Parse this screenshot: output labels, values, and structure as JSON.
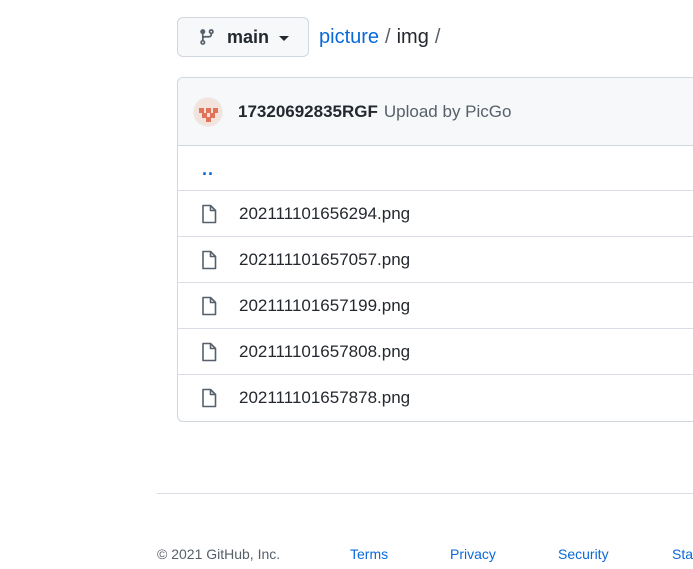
{
  "branch": {
    "label": "main",
    "icon": "git-branch-icon"
  },
  "breadcrumb": {
    "repo": "picture",
    "separator": "/",
    "folder": "img",
    "trailing": "/"
  },
  "commit": {
    "author": "17320692835RGF",
    "message": "Upload by PicGo"
  },
  "files": {
    "parent": "..",
    "items": [
      {
        "name": "202111101656294.png",
        "icon": "file-icon"
      },
      {
        "name": "202111101657057.png",
        "icon": "file-icon"
      },
      {
        "name": "202111101657199.png",
        "icon": "file-icon"
      },
      {
        "name": "202111101657808.png",
        "icon": "file-icon"
      },
      {
        "name": "202111101657878.png",
        "icon": "file-icon"
      }
    ]
  },
  "footer": {
    "copyright": "© 2021 GitHub, Inc.",
    "links": [
      "Terms",
      "Privacy",
      "Security",
      "Sta"
    ]
  },
  "colors": {
    "link": "#0969da",
    "text": "#24292f",
    "muted": "#57606a",
    "border": "#d0d7de",
    "header_bg": "#f6f8fa"
  }
}
